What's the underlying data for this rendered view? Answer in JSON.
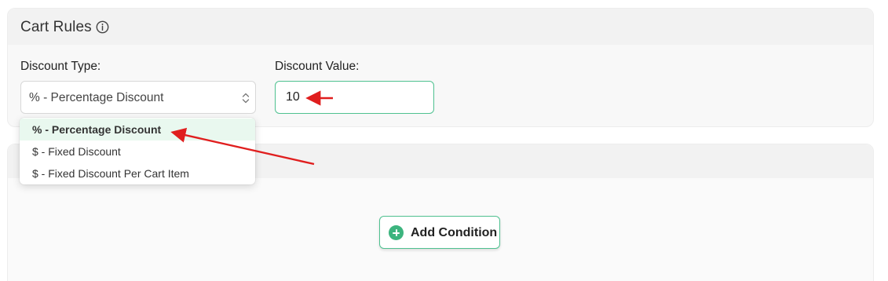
{
  "card": {
    "title": "Cart Rules",
    "info_icon": "info-icon"
  },
  "discount_type": {
    "label": "Discount Type:",
    "selected": "% - Percentage Discount",
    "options": [
      {
        "label": "% - Percentage Discount",
        "selected": true
      },
      {
        "label": "$ - Fixed Discount",
        "selected": false
      },
      {
        "label": "$ - Fixed Discount Per Cart Item",
        "selected": false
      }
    ]
  },
  "discount_value": {
    "label": "Discount Value:",
    "value": "10"
  },
  "conditions": {
    "add_button_label": "Add Condition",
    "add_icon": "plus-circle-icon"
  },
  "colors": {
    "accent": "#4fc190",
    "accent_dark": "#3cb47e",
    "selected_option_bg": "#e9f8ef",
    "annotation_arrow": "#e01e1e"
  }
}
